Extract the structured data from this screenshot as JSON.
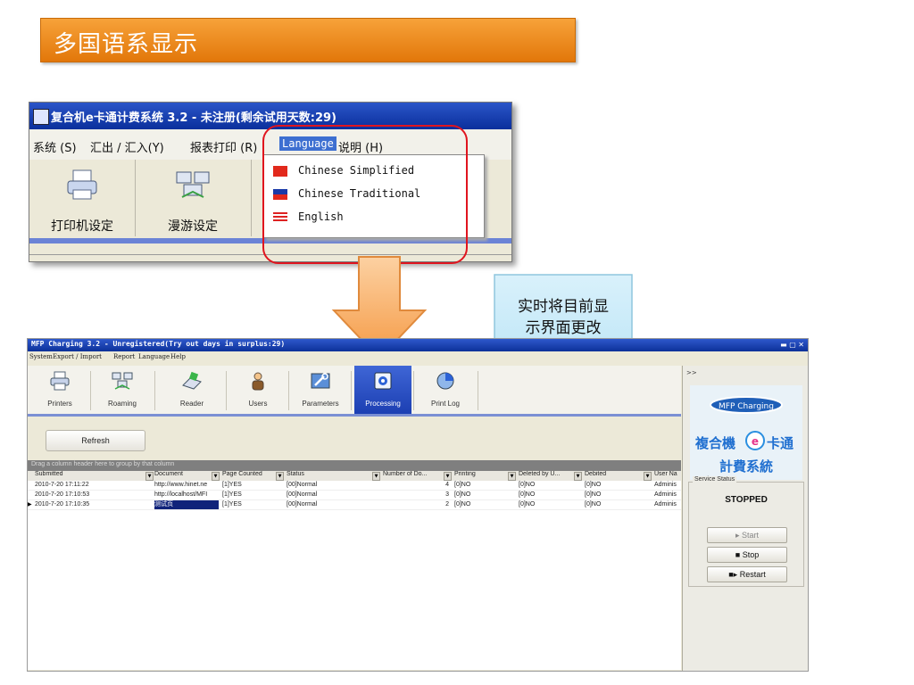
{
  "banner": {
    "title": "多国语系显示"
  },
  "top_window": {
    "title": "复合机e卡通计费系统 3.2 - 未注册(剩余试用天数:29)",
    "menu": [
      "系统 (S)",
      "汇出 / 汇入(Y)",
      "报表打印 (R)",
      "Language",
      "说明 (H)"
    ],
    "toolbar": [
      "打印机设定",
      "漫游设定"
    ],
    "language_menu": [
      "Chinese Simplified",
      "Chinese Traditional",
      "English"
    ]
  },
  "callout": {
    "line1": "实时将目前显",
    "line2": "示界面更改"
  },
  "bottom_window": {
    "title": "MFP Charging 3.2 - Unregistered(Try out days in surplus:29)",
    "menu": [
      "System",
      "Export / Import",
      "Report",
      "Language",
      "Help"
    ],
    "toolbar": [
      "Printers",
      "Roaming",
      "Reader",
      "Users",
      "Parameters",
      "Processing",
      "Print Log"
    ],
    "refresh_label": "Refresh",
    "group_hint": "Drag a column header here to group by that column",
    "columns": [
      "Submitted",
      "Document",
      "Page Counted",
      "Status",
      "Number of Do...",
      "Printing",
      "Deleted by U...",
      "Debited",
      "User Na"
    ],
    "rows": [
      [
        "2010-7-20 17:11:22",
        "http://www.hinet.ne",
        "[1]YES",
        "[00]Normal",
        "4",
        "[0]NO",
        "[0]NO",
        "[0]NO",
        "Adminis"
      ],
      [
        "2010-7-20 17:10:53",
        "http://localhost/MFI",
        "[1]YES",
        "[00]Normal",
        "3",
        "[0]NO",
        "[0]NO",
        "[0]NO",
        "Adminis"
      ],
      [
        "2010-7-20 17:10:35",
        "测试页",
        "[1]YES",
        "[00]Normal",
        "2",
        "[0]NO",
        "[0]NO",
        "[0]NO",
        "Adminis"
      ]
    ],
    "side_panel": {
      "collapse": ">>",
      "logo_top": "MFP Charging",
      "logo_left": "複合機",
      "logo_right": "卡通",
      "logo_bottom": "計費系統",
      "service_legend": "Service Status",
      "service_status": "STOPPED",
      "buttons": [
        "Start",
        "Stop",
        "Restart"
      ]
    },
    "accent": "#2a4fc0"
  }
}
